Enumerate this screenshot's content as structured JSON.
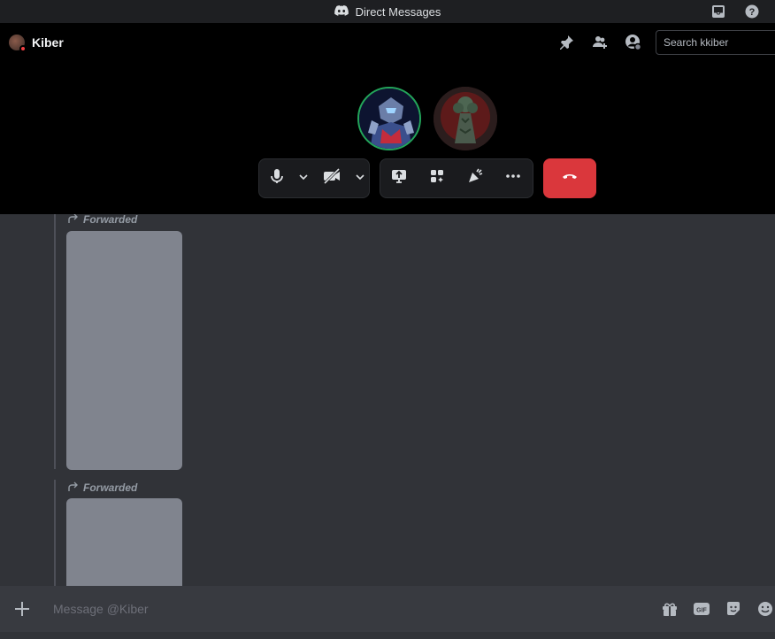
{
  "titlebar": {
    "title": "Direct Messages",
    "icons": [
      "discord-icon",
      "inbox-icon",
      "help-icon"
    ]
  },
  "call": {
    "user_name": "Kiber",
    "search_placeholder": "Search kkiber",
    "header_icons": [
      "pin-icon",
      "add-friend-icon",
      "profile-icon"
    ],
    "controls": [
      "microphone-icon",
      "chevron-down-icon",
      "camera-off-icon",
      "chevron-down-icon",
      "screen-share-icon",
      "activities-icon",
      "soundboard-icon",
      "more-icon",
      "hangup-icon"
    ]
  },
  "messages": [
    {
      "label": "Forwarded"
    },
    {
      "label": "Forwarded"
    }
  ],
  "composer": {
    "placeholder": "Message @Kiber",
    "icons": [
      "plus-icon",
      "gift-icon",
      "gif-icon",
      "sticker-icon",
      "emoji-icon"
    ]
  },
  "colors": {
    "background": "#313338",
    "hangup": "#da373c",
    "speaking_ring": "#23a55a",
    "status_dnd": "#f23f43"
  }
}
